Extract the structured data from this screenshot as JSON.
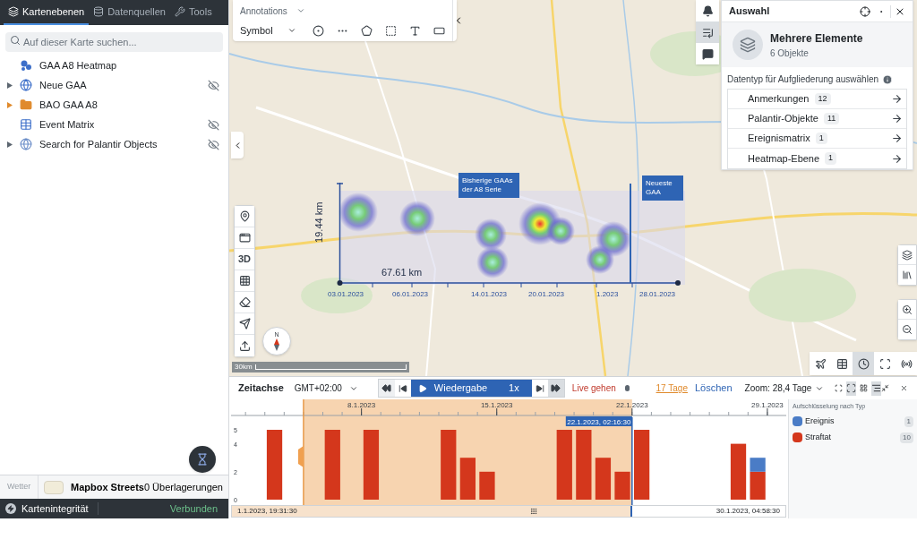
{
  "sidebar": {
    "tabs": [
      {
        "label": "Kartenebenen",
        "selected": true
      },
      {
        "label": "Datenquellen",
        "selected": false
      },
      {
        "label": "Tools",
        "selected": false
      }
    ],
    "search": {
      "placeholder": "Auf dieser Karte suchen..."
    },
    "layers": [
      {
        "name": "GAA A8 Heatmap",
        "kind": "heatmap",
        "expandable": false,
        "hidden": false
      },
      {
        "name": "Neue GAA",
        "kind": "globe",
        "expandable": true,
        "hidden": true
      },
      {
        "name": "BAO GAA A8",
        "kind": "folder",
        "expandable": true,
        "hidden": false
      },
      {
        "name": "Event Matrix",
        "kind": "table",
        "expandable": false,
        "hidden": true
      },
      {
        "name": "Search for Palantir Objects",
        "kind": "search",
        "expandable": true,
        "hidden": true
      }
    ],
    "basemap": {
      "weather_label": "Wetter",
      "name": "Mapbox Streets",
      "overlays": "0 Überlagerungen"
    },
    "status": {
      "label": "Kartenintegrität",
      "state": "Verbunden"
    }
  },
  "annotations_toolbar": {
    "title": "Annotations",
    "mode": "Symbol"
  },
  "map": {
    "scale": "30km",
    "compass": "N",
    "view_3d": "3D",
    "callouts": [
      {
        "kind": "past",
        "text": "Bisherige GAAs der A8 Serie"
      },
      {
        "kind": "latest",
        "text": "Neueste GAA"
      }
    ],
    "height_label": "19.44 km",
    "width_label": "67.61 km",
    "dates": [
      "03.01.2023",
      "06.01.2023",
      "14.01.2023",
      "20.01.2023",
      "1.2023",
      "28.01.2023"
    ]
  },
  "selection_panel": {
    "title": "Auswahl",
    "name": "Mehrere Elemente",
    "subtitle": "6 Objekte",
    "prompt": "Datentyp für Aufgliederung auswählen",
    "types": [
      {
        "label": "Anmerkungen",
        "count": "12"
      },
      {
        "label": "Palantir-Objekte",
        "count": "11"
      },
      {
        "label": "Ereignismatrix",
        "count": "1"
      },
      {
        "label": "Heatmap-Ebene",
        "count": "1"
      }
    ]
  },
  "timeline": {
    "title": "Zeitachse",
    "timezone": "GMT+02:00",
    "play_label": "Wiedergabe",
    "speed": "1x",
    "live_label": "Live gehen",
    "range_label": "17 Tage",
    "clear_label": "Löschen",
    "zoom_label": "Zoom: 28,4 Tage",
    "start": "1.1.2023, 19:31:30",
    "end": "30.1.2023, 04:58:30",
    "legend_title": "Aufschlüsselung nach Typ",
    "legend": [
      {
        "count": "1"
      },
      {
        "count": "10"
      }
    ],
    "chart_data": {
      "type": "bar",
      "stacked": true,
      "categories": [
        null,
        null,
        null,
        null,
        null,
        null,
        "8.1.2023",
        null,
        null,
        null,
        null,
        null,
        null,
        "15.1.2023",
        null,
        null,
        null,
        null,
        null,
        null,
        "22.1.2023",
        null,
        null,
        null,
        null,
        null,
        null,
        "29.1.2023"
      ],
      "series": [
        {
          "name": "Ereignis",
          "color": "#4a7cc6",
          "values": [
            0,
            0,
            0,
            0,
            0,
            0,
            0,
            0,
            0,
            0,
            0,
            0,
            0,
            0,
            0,
            0,
            0,
            0,
            0,
            0,
            0,
            0,
            0,
            0,
            0,
            0,
            1,
            0
          ]
        },
        {
          "name": "Straftat",
          "color": "#d4371c",
          "values": [
            0,
            5,
            0,
            0,
            5,
            0,
            5,
            0,
            0,
            0,
            5,
            3,
            2,
            0,
            0,
            0,
            5,
            5,
            3,
            2,
            5,
            0,
            0,
            0,
            0,
            4,
            2,
            0
          ]
        }
      ],
      "ylim": [
        0,
        5
      ],
      "yticks": [
        0,
        2,
        4,
        5
      ],
      "annotations": [
        "22.1.2023, 02:16:30"
      ]
    }
  }
}
